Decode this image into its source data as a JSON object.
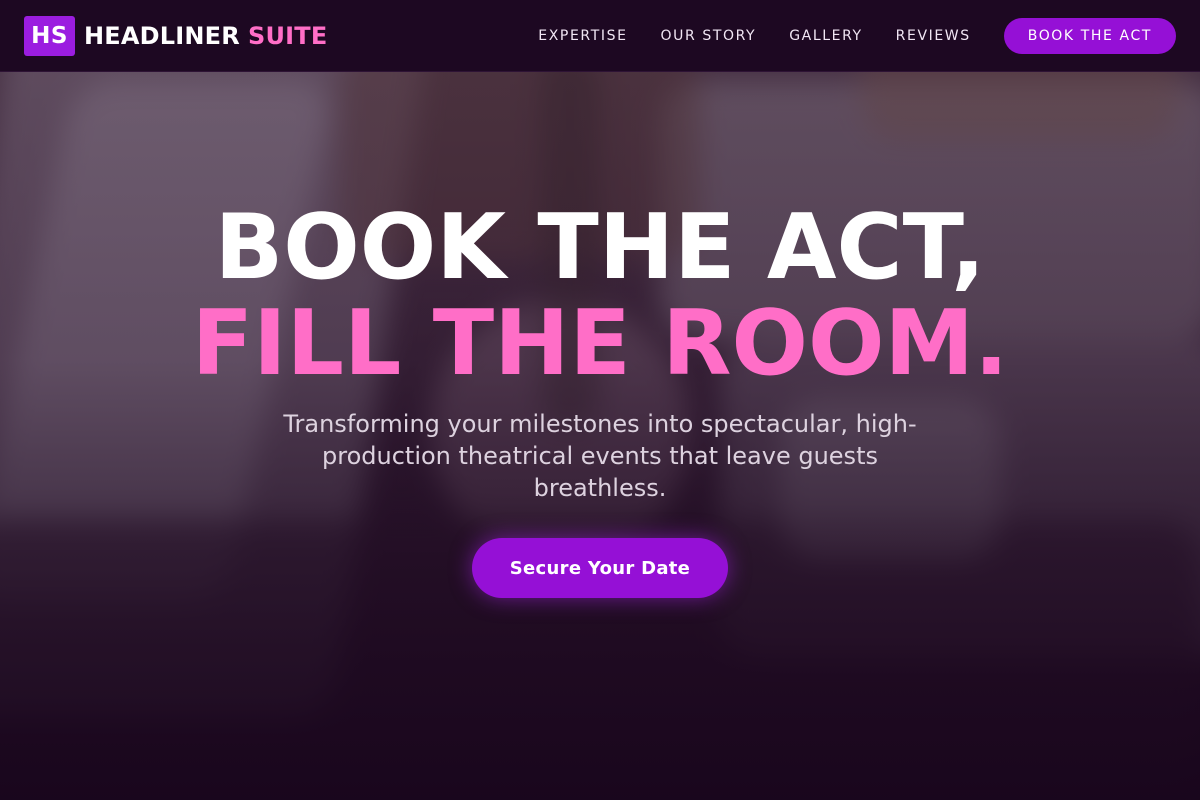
{
  "brand": {
    "logo_badge": "HS",
    "name": "HEADLINER",
    "accent": "SUITE"
  },
  "nav": {
    "items": [
      {
        "label": "EXPERTISE"
      },
      {
        "label": "OUR STORY"
      },
      {
        "label": "GALLERY"
      },
      {
        "label": "REVIEWS"
      }
    ],
    "cta_label": "BOOK THE ACT"
  },
  "hero": {
    "headline_line1": "BOOK THE ACT,",
    "headline_line2": "FILL THE ROOM.",
    "subtitle": "Transforming your milestones into spectacular, high-production theatrical events that leave guests breathless.",
    "cta_label": "Secure Your Date"
  },
  "colors": {
    "nav_background": "#1d0822",
    "accent_purple": "#9510d6",
    "accent_pink": "#ff6ec7",
    "text_white": "#ffffff"
  }
}
